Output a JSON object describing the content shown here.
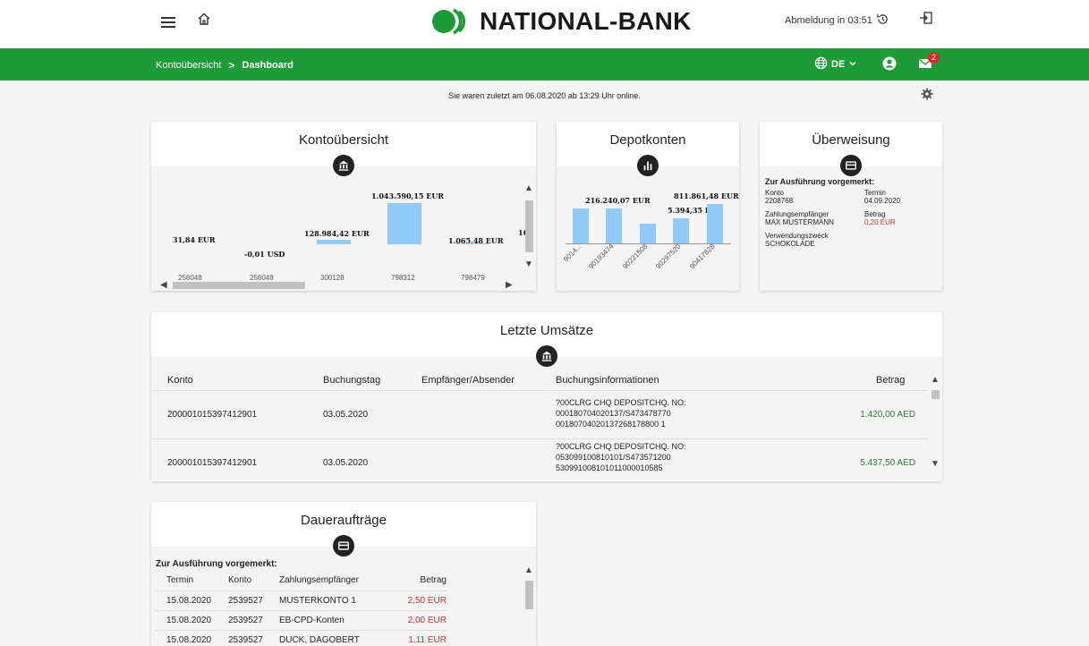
{
  "header": {
    "brand_name": "NATIONAL-BANK",
    "logout_text": "Abmeldung in 03:51",
    "brand_color": "#1c9b37"
  },
  "nav": {
    "crumb_parent": "Kontoübersicht",
    "crumb_separator": ">",
    "crumb_current": "Dashboard",
    "language": "DE",
    "mail_badge": "2"
  },
  "last_login": "Sie waren zuletzt am 06.08.2020 ab 13:29 Uhr online.",
  "konto_card": {
    "title": "Kontoübersicht",
    "icon": "bank-icon",
    "bars": [
      {
        "label": "31,84 EUR",
        "tick": "256048",
        "value": 31.84
      },
      {
        "label": "-0,01 USD",
        "tick": "256048",
        "value": -0.01
      },
      {
        "label": "128.984,42 EUR",
        "tick": "300128",
        "value": 128984.42
      },
      {
        "label": "1.043.590,15 EUR",
        "tick": "798312",
        "value": 1043590.15
      },
      {
        "label": "1.065,48 EUR",
        "tick": "798479",
        "value": 1065.48
      }
    ],
    "cut_label": "16"
  },
  "depot_card": {
    "title": "Depotkonten",
    "icon": "bar-chart-icon",
    "labels": [
      "216.240,07 EUR",
      "811.861,48 EUR",
      "5.394,35 EUR"
    ],
    "ticks": [
      "9014...",
      "90193474",
      "90221508",
      "90297520",
      "90417828"
    ],
    "values": [
      216240.07,
      216240.07,
      5394.35,
      5394.35,
      811861.48
    ]
  },
  "ueberweisung_card": {
    "title": "Überweisung",
    "icon": "card-icon",
    "scheduled": "Zur Ausführung vorgemerkt:",
    "konto_label": "Konto",
    "konto_value": "2208768",
    "termin_label": "Termin",
    "termin_value": "04.09.2020",
    "empf_label": "Zahlungsempfänger",
    "empf_value": "MAX MUSTERMANN",
    "betrag_label": "Betrag",
    "betrag_value": "0,20 EUR",
    "zweck_label": "Verwendungszweck",
    "zweck_value": "SCHOKOLADE"
  },
  "umsaetze_card": {
    "title": "Letzte Umsätze",
    "icon": "bank-icon",
    "columns": [
      "Konto",
      "Buchungstag",
      "Empfänger/Absender",
      "Buchungsinformationen",
      "Betrag"
    ],
    "rows": [
      {
        "konto": "200001015397412901",
        "tag": "03.05.2020",
        "empf": "",
        "info1": "?00CLRG CHQ DEPOSITCHQ. NO:",
        "info2": "000180704020137/S473478770",
        "info3": "00180704020137268178800 1",
        "betrag": "1.420,00 AED"
      },
      {
        "konto": "200001015397412901",
        "tag": "03.05.2020",
        "empf": "",
        "info1": "?00CLRG CHQ DEPOSITCHQ. NO:",
        "info2": "053099100810101/S473571200",
        "info3": "530991008101011000010585",
        "betrag": "5.437,50 AED"
      }
    ]
  },
  "dauer_card": {
    "title": "Daueraufträge",
    "icon": "card-icon",
    "scheduled": "Zur Ausführung vorgemerkt:",
    "columns": [
      "Termin",
      "Konto",
      "Zahlungsempfänger",
      "Betrag"
    ],
    "rows": [
      {
        "termin": "15.08.2020",
        "konto": "2539527",
        "empf": "MUSTERKONTO 1",
        "betrag": "2,50 EUR"
      },
      {
        "termin": "15.08.2020",
        "konto": "2539527",
        "empf": "EB-CPD-Konten",
        "betrag": "2,00 EUR"
      },
      {
        "termin": "15.08.2020",
        "konto": "2539527",
        "empf": "DUCK, DAGOBERT",
        "betrag": "1,11 EUR"
      }
    ]
  }
}
